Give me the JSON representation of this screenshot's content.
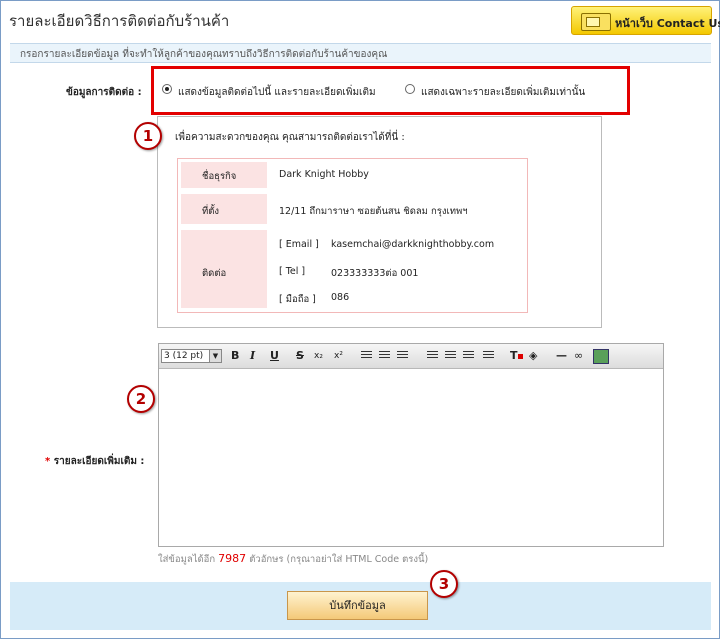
{
  "header": {
    "title": "รายละเอียดวิธีการติดต่อกับร้านค้า",
    "contact_button": "หน้าเว็บ Contact Us"
  },
  "instruction": "กรอกรายละเอียดข้อมูล ที่จะทำให้ลูกค้าของคุณทราบถึงวิธีการติดต่อกับร้านค้าของคุณ",
  "contact_info": {
    "label": "ข้อมูลการติดต่อ :",
    "options": [
      {
        "label": "แสดงข้อมูลติดต่อไปนี้ และรายละเอียดเพิ่มเติม",
        "selected": true
      },
      {
        "label": "แสดงเฉพาะรายละเอียดเพิ่มเติมเท่านั้น",
        "selected": false
      }
    ]
  },
  "preview": {
    "intro": "เพื่อความสะดวกของคุณ คุณสามารถติดต่อเราได้ที่นี่ :",
    "business_label": "ชื่อธุรกิจ",
    "business_value": "Dark Knight Hobby",
    "address_label": "ที่ตั้ง",
    "address_value": "12/11 ถึกมาราษา ซอยต้นสน ชิดลม กรุงเทพฯ",
    "contact_label": "ติดต่อ",
    "email_key": "[ Email ]",
    "email_value": "kasemchai@darkknighthobby.com",
    "tel_key": "[ Tel ]",
    "tel_value": "023333333ต่อ 001",
    "mobile_key": "[ มือถือ ]",
    "mobile_value": "086"
  },
  "details": {
    "required_mark": "*",
    "label": "รายละเอียดเพิ่มเติม :",
    "font_size": "3 (12 pt)",
    "toolbar": {
      "bold": "B",
      "italic": "I",
      "underline": "U",
      "strike": "S",
      "subscript": "x₂",
      "superscript": "x²"
    }
  },
  "counter": {
    "prefix": "ใส่ข้อมูลได้อีก",
    "remaining": "7987",
    "suffix": "ตัวอักษร (กรุณาอย่าใส่ HTML Code ตรงนี้)"
  },
  "save_button": "บันทึกข้อมูล",
  "callouts": [
    "1",
    "2",
    "3"
  ],
  "colors": {
    "highlight": "#e30000",
    "footer": "#d6ebf8",
    "accent_button": "#f3c800"
  }
}
